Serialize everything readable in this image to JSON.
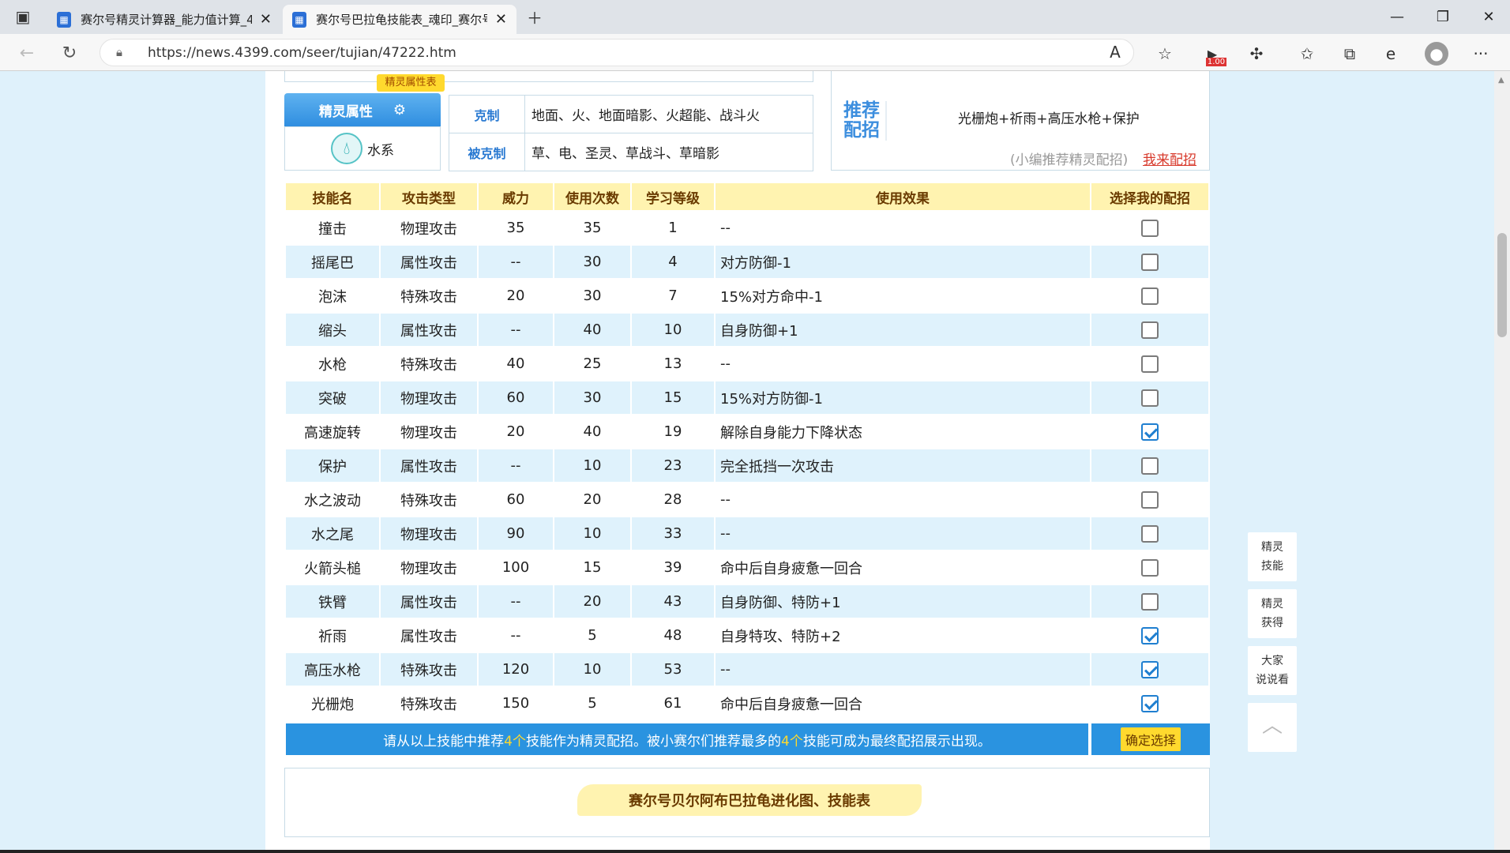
{
  "tabs": [
    {
      "title": "赛尔号精灵计算器_能力值计算_4"
    },
    {
      "title": "赛尔号巴拉龟技能表_魂印_赛尔号"
    }
  ],
  "browser": {
    "url": "https://news.4399.com/seer/tujian/47222.htm",
    "badge": "1.00"
  },
  "attribute": {
    "badge": "精灵属性表",
    "header": "精灵属性",
    "value": "水系"
  },
  "relations": {
    "counter_label": "克制",
    "counter_value": "地面、火、地面暗影、火超能、战斗火",
    "countered_label": "被克制",
    "countered_value": "草、电、圣灵、草战斗、草暗影"
  },
  "recommend": {
    "label": "推荐配招",
    "combo": "光栅炮+祈雨+高压水枪+保护",
    "hint": "(小编推荐精灵配招)",
    "link": "我来配招"
  },
  "skills": {
    "headers": [
      "技能名",
      "攻击类型",
      "威力",
      "使用次数",
      "学习等级",
      "使用效果",
      "选择我的配招"
    ],
    "rows": [
      {
        "name": "撞击",
        "type": "物理攻击",
        "power": "35",
        "pp": "35",
        "level": "1",
        "effect": "--",
        "checked": false
      },
      {
        "name": "摇尾巴",
        "type": "属性攻击",
        "power": "--",
        "pp": "30",
        "level": "4",
        "effect": "对方防御-1",
        "checked": false
      },
      {
        "name": "泡沫",
        "type": "特殊攻击",
        "power": "20",
        "pp": "30",
        "level": "7",
        "effect": "15%对方命中-1",
        "checked": false
      },
      {
        "name": "缩头",
        "type": "属性攻击",
        "power": "--",
        "pp": "40",
        "level": "10",
        "effect": "自身防御+1",
        "checked": false
      },
      {
        "name": "水枪",
        "type": "特殊攻击",
        "power": "40",
        "pp": "25",
        "level": "13",
        "effect": "--",
        "checked": false
      },
      {
        "name": "突破",
        "type": "物理攻击",
        "power": "60",
        "pp": "30",
        "level": "15",
        "effect": "15%对方防御-1",
        "checked": false
      },
      {
        "name": "高速旋转",
        "type": "物理攻击",
        "power": "20",
        "pp": "40",
        "level": "19",
        "effect": "解除自身能力下降状态",
        "checked": true
      },
      {
        "name": "保护",
        "type": "属性攻击",
        "power": "--",
        "pp": "10",
        "level": "23",
        "effect": "完全抵挡一次攻击",
        "checked": false
      },
      {
        "name": "水之波动",
        "type": "特殊攻击",
        "power": "60",
        "pp": "20",
        "level": "28",
        "effect": "--",
        "checked": false
      },
      {
        "name": "水之尾",
        "type": "物理攻击",
        "power": "90",
        "pp": "10",
        "level": "33",
        "effect": "--",
        "checked": false
      },
      {
        "name": "火箭头槌",
        "type": "物理攻击",
        "power": "100",
        "pp": "15",
        "level": "39",
        "effect": "命中后自身疲惫一回合",
        "checked": false
      },
      {
        "name": "铁臂",
        "type": "属性攻击",
        "power": "--",
        "pp": "20",
        "level": "43",
        "effect": "自身防御、特防+1",
        "checked": false
      },
      {
        "name": "祈雨",
        "type": "属性攻击",
        "power": "--",
        "pp": "5",
        "level": "48",
        "effect": "自身特攻、特防+2",
        "checked": true
      },
      {
        "name": "高压水枪",
        "type": "特殊攻击",
        "power": "120",
        "pp": "10",
        "level": "53",
        "effect": "--",
        "checked": true
      },
      {
        "name": "光栅炮",
        "type": "特殊攻击",
        "power": "150",
        "pp": "5",
        "level": "61",
        "effect": "命中后自身疲惫一回合",
        "checked": true
      }
    ]
  },
  "footer": {
    "msg_a": "请从以上技能中推荐",
    "n1": "4个",
    "msg_b": "技能作为精灵配招。被小赛尔们推荐最多的",
    "n2": "4个",
    "msg_c": "技能可成为最终配招展示出现。",
    "confirm": "确定选择"
  },
  "evolution": {
    "title": "赛尔号贝尔阿布巴拉龟进化图、技能表"
  },
  "side": {
    "b1a": "精灵",
    "b1b": "技能",
    "b2a": "精灵",
    "b2b": "获得",
    "b3a": "大家",
    "b3b": "说说看"
  }
}
